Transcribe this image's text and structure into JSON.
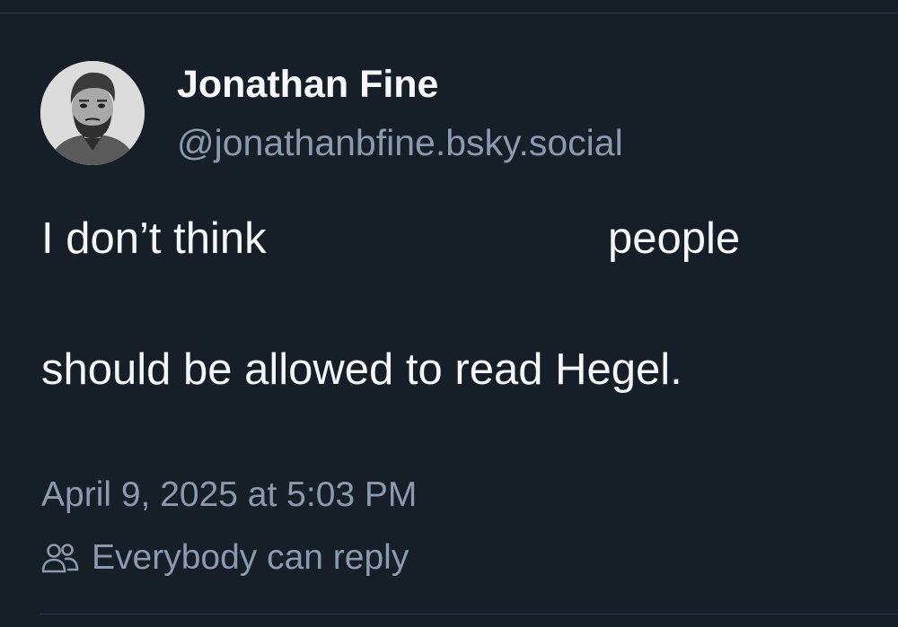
{
  "post": {
    "author": {
      "display_name": "Jonathan Fine",
      "handle": "@jonathanbfine.bsky.social"
    },
    "text": {
      "part1": "I don’t think",
      "part2": "people",
      "part3": "should be allowed to read Hegel."
    },
    "timestamp": "April 9, 2025 at 5:03 PM",
    "reply_setting": {
      "icon": "people-icon",
      "label": "Everybody can reply"
    }
  },
  "colors": {
    "background": "#161e27",
    "primary_text": "#f4f6f8",
    "secondary_text": "#8a9aaf",
    "divider": "#2b3744"
  }
}
